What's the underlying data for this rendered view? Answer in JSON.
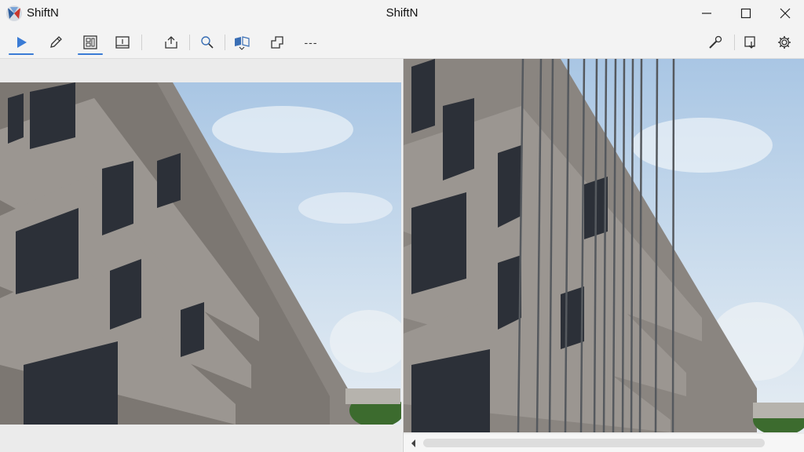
{
  "app": {
    "name": "ShiftN",
    "window_title": "ShiftN",
    "icon": "shiftn-logo-icon"
  },
  "window_controls": [
    {
      "name": "minimize",
      "icon": "minimize-icon"
    },
    {
      "name": "maximize",
      "icon": "maximize-icon"
    },
    {
      "name": "close",
      "icon": "close-icon"
    }
  ],
  "toolbar": {
    "accent_color": "#3a7bd5",
    "active_tools": [
      "play",
      "layout"
    ],
    "left_tools": [
      {
        "name": "play",
        "icon": "play-icon"
      },
      {
        "name": "edit",
        "icon": "pencil-icon"
      },
      {
        "name": "layout",
        "icon": "layout-grid-icon"
      },
      {
        "name": "image-bottom",
        "icon": "image-frame-icon"
      },
      {
        "name": "export",
        "icon": "upload-box-icon"
      },
      {
        "name": "zoom",
        "icon": "zoom-icon"
      },
      {
        "name": "mirror",
        "icon": "mirror-icon"
      },
      {
        "name": "crop",
        "icon": "crop-icon"
      },
      {
        "name": "more",
        "icon": "more-icon",
        "label": "---"
      }
    ],
    "right_tools": [
      {
        "name": "tools",
        "icon": "wrench-icon"
      },
      {
        "name": "import",
        "icon": "import-icon"
      },
      {
        "name": "settings",
        "icon": "gear-icon"
      }
    ]
  },
  "panels": {
    "left": {
      "content": "original-photo"
    },
    "right": {
      "content": "corrected-photo"
    }
  },
  "scrollbar": {
    "arrow_icon": "arrow-left-icon"
  }
}
